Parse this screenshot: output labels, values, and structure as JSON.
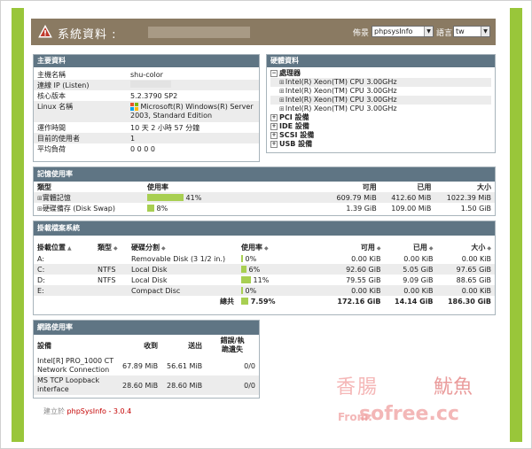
{
  "header": {
    "title": "系統資料 :",
    "template_label": "佈景",
    "template_value": "phpsysInfo",
    "language_label": "語言",
    "language_value": "tw"
  },
  "vitals": {
    "title": "主要資料",
    "rows": [
      {
        "k": "主機名稱",
        "v": "shu-color"
      },
      {
        "k": "連線 IP (Listen)",
        "v": ""
      },
      {
        "k": "核心版本",
        "v": "5.2.3790 SP2"
      },
      {
        "k": "Linux 名稱",
        "v": "Microsoft(R) Windows(R) Server 2003, Standard Edition"
      },
      {
        "k": "運作時間",
        "v": "10 天 2 小時 57 分鐘"
      },
      {
        "k": "目前的使用者",
        "v": "1"
      },
      {
        "k": "平均負荷",
        "v": "0 0 0 0"
      }
    ]
  },
  "hardware": {
    "title": "硬體資料",
    "processor_label": "處理器",
    "cpus": [
      "Intel(R) Xeon(TM) CPU 3.00GHz",
      "Intel(R) Xeon(TM) CPU 3.00GHz",
      "Intel(R) Xeon(TM) CPU 3.00GHz",
      "Intel(R) Xeon(TM) CPU 3.00GHz"
    ],
    "devices": [
      "PCI 設備",
      "IDE 設備",
      "SCSI 設備",
      "USB 設備"
    ]
  },
  "memory": {
    "title": "記憶使用率",
    "headers": {
      "type": "類型",
      "usage": "使用率",
      "free": "可用",
      "used": "已用",
      "size": "大小"
    },
    "rows": [
      {
        "type": "實體記憶",
        "percent": 41,
        "percent_text": "41%",
        "free": "609.79 MiB",
        "used": "412.60 MiB",
        "size": "1022.39 MiB"
      },
      {
        "type": "硬碟備存 (Disk Swap)",
        "percent": 8,
        "percent_text": "8%",
        "free": "1.39 GiB",
        "used": "109.00 MiB",
        "size": "1.50 GiB"
      }
    ]
  },
  "filesystems": {
    "title": "掛載檔案系統",
    "headers": {
      "mount": "掛載位置",
      "type": "類型",
      "partition": "硬碟分割",
      "usage": "使用率",
      "free": "可用",
      "used": "已用",
      "size": "大小"
    },
    "rows": [
      {
        "mount": "A:",
        "type": "",
        "partition": "Removable Disk (3 1/2 in.)",
        "percent": 0,
        "percent_text": "0%",
        "free": "0.00 KiB",
        "used": "0.00 KiB",
        "size": "0.00 KiB"
      },
      {
        "mount": "C:",
        "type": "NTFS",
        "partition": "Local Disk",
        "percent": 6,
        "percent_text": "6%",
        "free": "92.60 GiB",
        "used": "5.05 GiB",
        "size": "97.65 GiB"
      },
      {
        "mount": "D:",
        "type": "NTFS",
        "partition": "Local Disk",
        "percent": 11,
        "percent_text": "11%",
        "free": "79.55 GiB",
        "used": "9.09 GiB",
        "size": "88.65 GiB"
      },
      {
        "mount": "E:",
        "type": "",
        "partition": "Compact Disc",
        "percent": 0,
        "percent_text": "0%",
        "free": "0.00 KiB",
        "used": "0.00 KiB",
        "size": "0.00 KiB"
      }
    ],
    "total": {
      "label": "總共",
      "percent": 7.59,
      "percent_text": "7.59%",
      "free": "172.16 GiB",
      "used": "14.14 GiB",
      "size": "186.30 GiB"
    }
  },
  "network": {
    "title": "網路使用率",
    "headers": {
      "device": "設備",
      "recv": "收到",
      "sent": "送出",
      "errors_line1": "錯誤/執",
      "errors_line2": "跪遺失"
    },
    "rows": [
      {
        "device_line1": "Intel[R] PRO_1000 CT",
        "device_line2": "Network Connection",
        "recv": "67.89 MiB",
        "sent": "56.61 MiB",
        "errors": "0/0"
      },
      {
        "device_line1": "MS TCP Loopback",
        "device_line2": "interface",
        "recv": "28.60 MiB",
        "sent": "28.60 MiB",
        "errors": "0/0"
      }
    ]
  },
  "footer": {
    "prefix": "建立於",
    "link": "phpSysInfo - 3.0.4"
  },
  "watermark": {
    "left": "香腸",
    "right": "魷魚",
    "from": "From:",
    "site": "sofree.cc"
  },
  "colors": {
    "accent_green": "#99c63a",
    "header_brown": "#8a7a62",
    "panel_header": "#5f7584",
    "bar_green": "#a8cf52",
    "link_red": "#c40000"
  }
}
